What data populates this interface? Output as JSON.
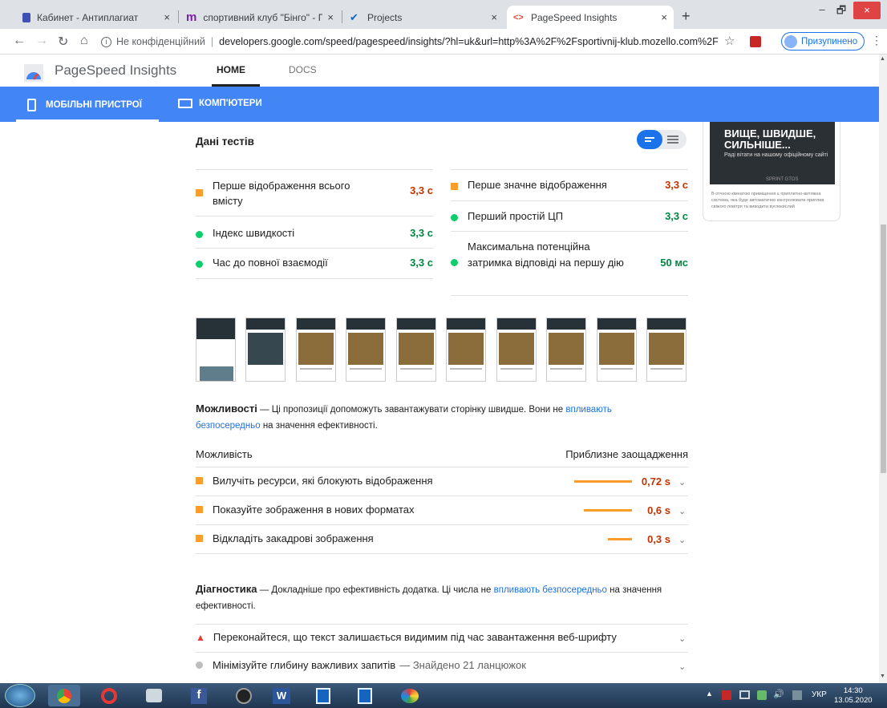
{
  "browser": {
    "tabs": [
      {
        "title": "Кабинет - Антиплагиат"
      },
      {
        "title": "спортивний клуб \"Бінго\" - Поча"
      },
      {
        "title": "Projects"
      },
      {
        "title": "PageSpeed Insights"
      }
    ],
    "new_tab": "+",
    "close_glyph": "×",
    "window_min": "–",
    "window_max": "🗗",
    "window_close": "×",
    "address_security": "Не конфіденційний",
    "address_url": "developers.google.com/speed/pagespeed/insights/?hl=uk&url=http%3A%2F%2Fsportivnij-klub.mozello.com%2F",
    "profile_label": "Призупинено"
  },
  "psi": {
    "title": "PageSpeed Insights",
    "nav_home": "HOME",
    "nav_docs": "DOCS",
    "tab_mobile": "МОБІЛЬНІ ПРИСТРОЇ",
    "tab_desktop": "КОМП'ЮТЕРИ"
  },
  "preview": {
    "headline": "ВИЩЕ, ШВИДШЕ, СИЛЬНІШЕ...",
    "sub": "Раді вітати на нашому офіційному сайті",
    "banner": "SPRINT GTOS",
    "caption": "В отчною кімнатою приміщення є приплитно-витяжна система, яка буде автоматично контролювати приплив свіжого повітря та виводити вуглекислий"
  },
  "lab": {
    "heading": "Дані тестів",
    "metrics_left": [
      {
        "label": "Перше відображення всього вмісту",
        "value": "3,3 с",
        "status": "orange"
      },
      {
        "label": "Індекс швидкості",
        "value": "3,3 с",
        "status": "green"
      },
      {
        "label": "Час до повної взаємодії",
        "value": "3,3 с",
        "status": "green"
      }
    ],
    "metrics_right": [
      {
        "label": "Перше значне відображення",
        "value": "3,3 с",
        "status": "orange"
      },
      {
        "label": "Перший простій ЦП",
        "value": "3,3 с",
        "status": "green"
      },
      {
        "label": "Максимальна потенційна затримка відповіді на першу дію",
        "value": "50 мс",
        "status": "green"
      }
    ]
  },
  "opportunities": {
    "title": "Можливості",
    "desc_1": " — Ці пропозиції допоможуть завантажувати сторінку швидше. Вони не ",
    "desc_link": "впливають безпосередньо",
    "desc_2": " на значення ефективності.",
    "col_left": "Можливість",
    "col_right": "Приблизне заощадження",
    "items": [
      {
        "label": "Вилучіть ресурси, які блокують відображення",
        "value": "0,72 s",
        "fraction": 1.0
      },
      {
        "label": "Показуйте зображення в нових форматах",
        "value": "0,6 s",
        "fraction": 0.83
      },
      {
        "label": "Відкладіть закадрові зображення",
        "value": "0,3 s",
        "fraction": 0.42
      }
    ]
  },
  "diagnostics": {
    "title": "Діагностика",
    "desc_1": " — Докладніше про ефективність додатка. Ці числа не ",
    "desc_link": "впливають безпосередньо",
    "desc_2": " на значення ефективності.",
    "items": [
      {
        "label": "Переконайтеся, що текст залишається видимим під час завантаження веб-шрифту"
      },
      {
        "label": "Мінімізуйте глибину важливих запитів",
        "extra": "— Знайдено 21 ланцюжок"
      }
    ]
  },
  "taskbar": {
    "lang": "УКР",
    "time": "14:30",
    "date": "13.05.2020"
  }
}
